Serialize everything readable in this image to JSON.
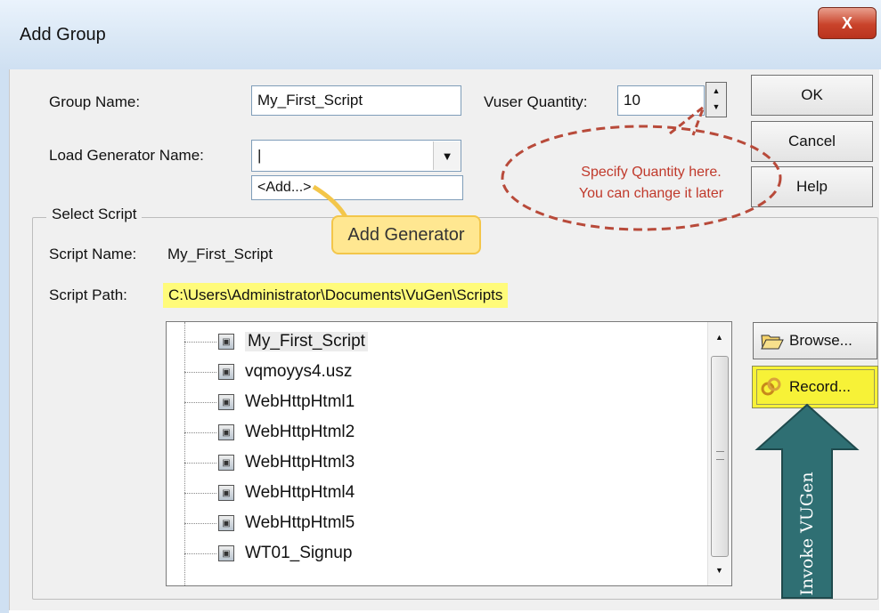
{
  "window": {
    "title": "Add Group",
    "close_glyph": "X"
  },
  "form": {
    "group_name_label": "Group Name:",
    "group_name_value": "My_First_Script",
    "vuser_quantity_label": "Vuser Quantity:",
    "vuser_quantity_value": "10",
    "load_generator_label": "Load Generator Name:",
    "load_generator_value": "",
    "load_generator_option": "<Add...>"
  },
  "buttons": {
    "ok": "OK",
    "cancel": "Cancel",
    "help": "Help",
    "browse": "Browse...",
    "record": "Record..."
  },
  "select_script": {
    "group_title": "Select Script",
    "script_name_label": "Script Name:",
    "script_name_value": "My_First_Script",
    "script_path_label": "Script Path:",
    "script_path_value": "C:\\Users\\Administrator\\Documents\\VuGen\\Scripts"
  },
  "scripts": [
    "My_First_Script",
    "vqmoyys4.usz",
    "WebHttpHtml1",
    "WebHttpHtml2",
    "WebHttpHtml3",
    "WebHttpHtml4",
    "WebHttpHtml5",
    "WT01_Signup"
  ],
  "annotations": {
    "add_generator": "Add Generator",
    "quantity_line1": "Specify Quantity here.",
    "quantity_line2": "You can change it later",
    "invoke_vugen": "Invoke VUGen"
  },
  "icons": {
    "folder": "folder-open-icon",
    "record": "record-icon",
    "script": "script-file-icon"
  },
  "colors": {
    "highlight": "#fffb7a",
    "callout_red": "#c0392b",
    "arrow_teal": "#2f6f73",
    "tag_yellow": "#ffe791"
  }
}
